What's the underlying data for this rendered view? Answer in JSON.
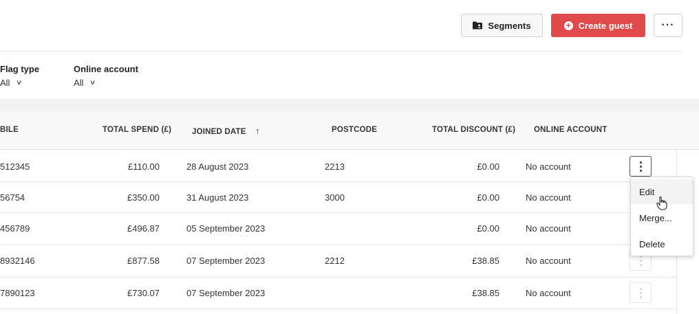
{
  "toolbar": {
    "segments_label": "Segments",
    "create_label": "Create guest",
    "more_label": "···"
  },
  "filters": [
    {
      "label": "Flag type",
      "value": "All"
    },
    {
      "label": "Online account",
      "value": "All"
    }
  ],
  "table": {
    "columns": [
      "BILE",
      "TOTAL SPEND (£)",
      "JOINED DATE",
      "POSTCODE",
      "TOTAL DISCOUNT (£)",
      "ONLINE ACCOUNT"
    ],
    "sort_indicator": "↑",
    "rows": [
      {
        "mobile": "512345",
        "spend": "£110.00",
        "joined": "28 August 2023",
        "postcode": "2213",
        "discount": "£0.00",
        "online": "No account"
      },
      {
        "mobile": "56754",
        "spend": "£350.00",
        "joined": "31 August 2023",
        "postcode": "3000",
        "discount": "£0.00",
        "online": "No account"
      },
      {
        "mobile": "456789",
        "spend": "£496.87",
        "joined": "05 September 2023",
        "postcode": "",
        "discount": "£0.00",
        "online": "No account"
      },
      {
        "mobile": "8932146",
        "spend": "£877.58",
        "joined": "07 September 2023",
        "postcode": "2212",
        "discount": "£38.85",
        "online": "No account"
      },
      {
        "mobile": "7890123",
        "spend": "£730.07",
        "joined": "07 September 2023",
        "postcode": "",
        "discount": "£38.85",
        "online": "No account"
      }
    ]
  },
  "context_menu": {
    "items": [
      "Edit",
      "Merge...",
      "Delete"
    ]
  },
  "colors": {
    "primary": "#e04a4a",
    "page_band": "#f1f2f4"
  }
}
